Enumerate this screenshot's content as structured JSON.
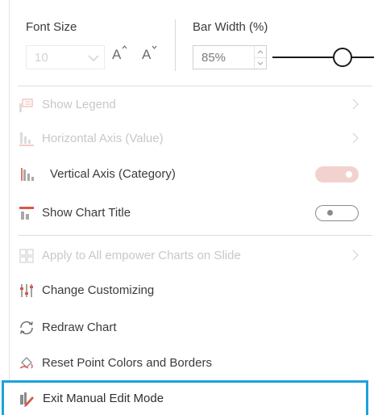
{
  "font_size": {
    "label": "Font Size",
    "value": "10",
    "grow_label": "A",
    "shrink_label": "A"
  },
  "bar_width": {
    "label": "Bar Width (%)",
    "value": "85%",
    "slider_level_percent": 85
  },
  "menu": {
    "show_legend": "Show Legend",
    "horizontal_axis": "Horizontal Axis (Value)",
    "vertical_axis": "Vertical Axis (Category)",
    "show_chart_title": "Show Chart Title",
    "apply_all": "Apply to All empower Charts on Slide",
    "change_customizing": "Change Customizing",
    "redraw_chart": "Redraw Chart",
    "reset_point_colors": "Reset Point Colors and Borders",
    "exit_manual_edit": "Exit Manual Edit Mode"
  },
  "toggles": {
    "vertical_axis_on": true,
    "show_chart_title_on": false
  },
  "colors": {
    "accent_pink": "#f2d2cf",
    "focus_blue": "#1aa3d9",
    "brand_red": "#d9574a"
  }
}
